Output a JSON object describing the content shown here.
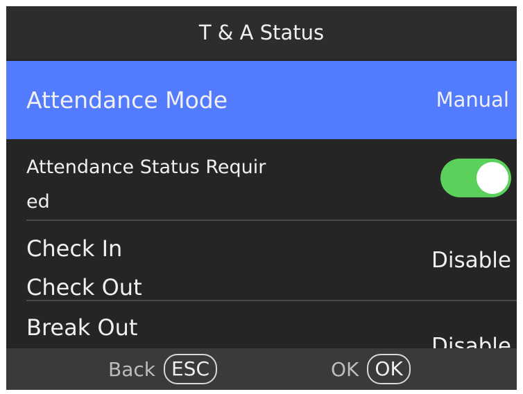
{
  "header": {
    "title": "T & A Status"
  },
  "settings": {
    "attendance_mode": {
      "label": "Attendance Mode",
      "value": "Manual"
    },
    "attendance_status_required": {
      "label_line1": "Attendance Status Requir",
      "label_line2": "ed",
      "enabled": true
    },
    "check_in_out": {
      "label_line1": "Check In",
      "label_line2": "Check Out",
      "value": "Disable"
    },
    "break_out": {
      "label_line1": "Break Out",
      "value": "Disable"
    }
  },
  "footer": {
    "back_label": "Back",
    "back_key": "ESC",
    "ok_label": "OK",
    "ok_key": "OK"
  },
  "colors": {
    "selected_row": "#527bff",
    "toggle_on": "#5bd05b",
    "background": "#252525",
    "footer": "#3a3a3c"
  }
}
